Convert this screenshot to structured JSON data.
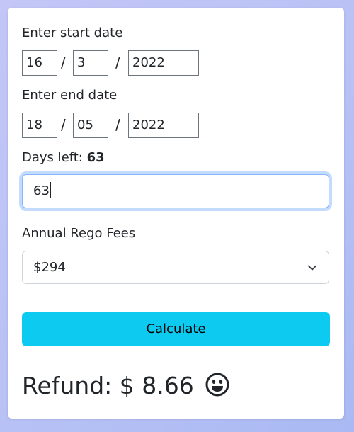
{
  "start": {
    "label": "Enter start date",
    "day": "16",
    "month": "3",
    "year": "2022",
    "separator": "/"
  },
  "end": {
    "label": "Enter end date",
    "day": "18",
    "month": "05",
    "year": "2022",
    "separator": "/"
  },
  "days_left": {
    "label": "Days left:",
    "value": "63",
    "input_value": "63"
  },
  "rego": {
    "label": "Annual Rego Fees",
    "selected": "$294"
  },
  "calculate_button": "Calculate",
  "refund": {
    "label": "Refund: $ 8.66",
    "icon": "smiley-face-icon"
  },
  "colors": {
    "button": "#0dcaf0",
    "focus_ring": "#86b7fe"
  }
}
